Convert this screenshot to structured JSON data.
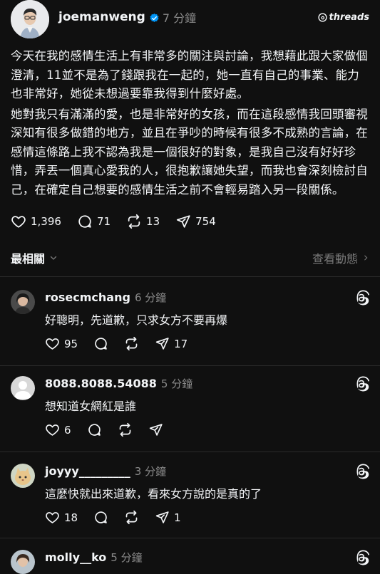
{
  "post": {
    "username": "joemanweng",
    "time": "7 分鐘",
    "brand": "threads",
    "paragraphs": [
      "今天在我的感情生活上有非常多的關注與討論，我想藉此跟大家做個澄清，11並不是為了錢跟我在一起的，她一直有自己的事業、能力也非常好，她從未想過要靠我得到什麼好處。",
      "她對我只有滿滿的愛，也是非常好的女孩，而在這段感情我回頭審視深知有很多做錯的地方，並且在爭吵的時候有很多不成熟的言論，在感情這條路上我不認為我是一個很好的對象，是我自己沒有好好珍惜，弄丟一個真心愛我的人，很抱歉讓她失望，而我也會深刻檢討自己，在確定自己想要的感情生活之前不會輕易踏入另一段關係。"
    ],
    "likes": "1,396",
    "replies": "71",
    "reposts": "13",
    "shares": "754"
  },
  "sort": {
    "label": "最相關",
    "activity": "查看動態"
  },
  "comments": [
    {
      "user": "rosecmchang",
      "time": "6 分鐘",
      "text": "好聰明，先道歉，只求女方不要再爆",
      "likes": "95",
      "shares": "17"
    },
    {
      "user": "8088.8088.54088",
      "time": "5 分鐘",
      "text": "想知道女網紅是誰",
      "likes": "6",
      "shares": ""
    },
    {
      "user": "joyyy_________",
      "time": "3 分鐘",
      "text": "這麼快就出來道歉，看來女方說的是真的了",
      "likes": "18",
      "shares": "1"
    },
    {
      "user": "molly__ko",
      "time": "5 分鐘",
      "text": "",
      "likes": "",
      "shares": ""
    }
  ],
  "colors": {
    "background": "#101010",
    "text": "#f3f5f7",
    "secondary": "#8a8a8a",
    "verified": "#0095f6"
  },
  "icons": [
    "heart-icon",
    "comment-icon",
    "repost-icon",
    "share-icon",
    "threads-logo-icon",
    "verified-badge-icon",
    "chevron-down-icon",
    "chevron-right-icon"
  ]
}
